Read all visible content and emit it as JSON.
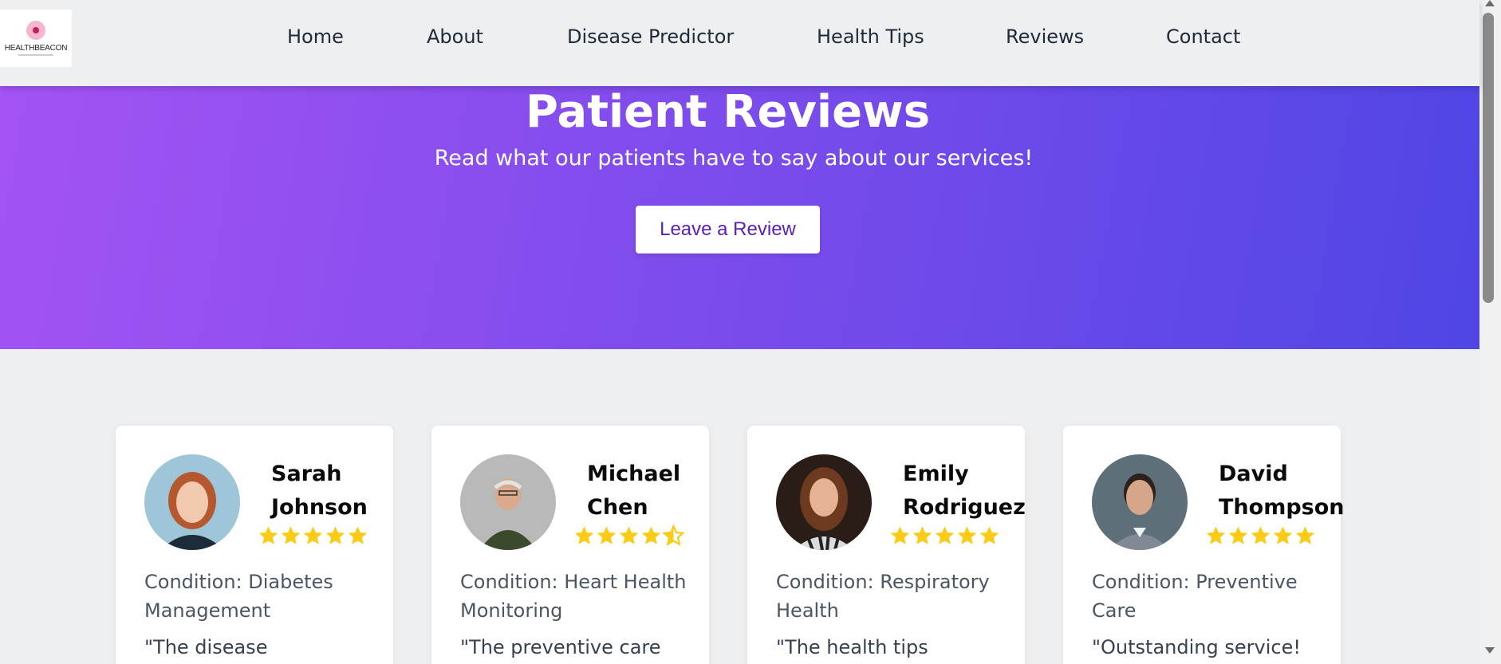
{
  "logo": {
    "text": "HEALTHBEACON"
  },
  "nav": [
    {
      "label": "Home"
    },
    {
      "label": "About"
    },
    {
      "label": "Disease Predictor"
    },
    {
      "label": "Health Tips"
    },
    {
      "label": "Reviews"
    },
    {
      "label": "Contact"
    }
  ],
  "hero": {
    "title": "Patient Reviews",
    "subtitle": "Read what our patients have to say about our services!",
    "button": "Leave a Review"
  },
  "reviews": [
    {
      "name": "Sarah Johnson",
      "rating": 5,
      "condition": "Condition: Diabetes Management",
      "quote": "\"The disease"
    },
    {
      "name": "Michael Chen",
      "rating": 4.5,
      "condition": "Condition: Heart Health Monitoring",
      "quote": "\"The preventive care"
    },
    {
      "name": "Emily Rodriguez",
      "rating": 5,
      "condition": "Condition: Respiratory Health",
      "quote": "\"The health tips"
    },
    {
      "name": "David Thompson",
      "rating": 5,
      "condition": "Condition: Preventive Care",
      "quote": "\"Outstanding service!"
    }
  ],
  "colors": {
    "gradient_start": "#a453f5",
    "gradient_end": "#4f46e5",
    "star": "#facc15",
    "button_text": "#5b21b6"
  }
}
